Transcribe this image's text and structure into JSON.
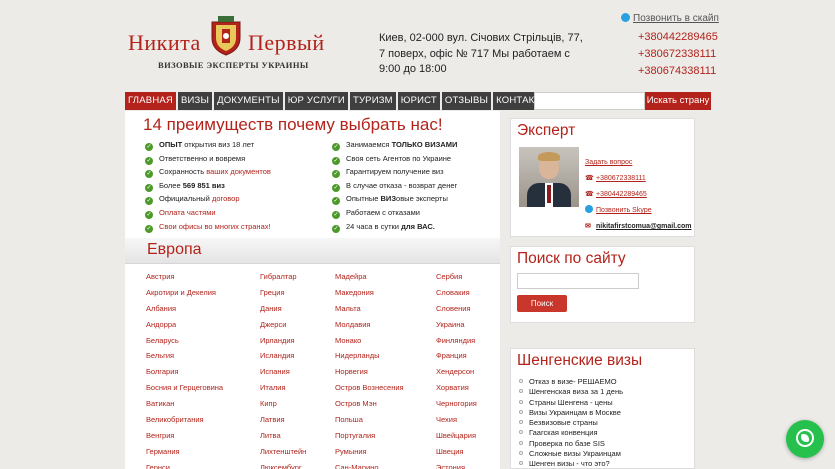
{
  "header": {
    "logo_word1": "Никита",
    "logo_word2": "Первый",
    "logo_sub": "ВИЗОВЫЕ ЭКСПЕРТЫ УКРАИНЫ",
    "address": "Киев, 02-000 вул. Січових Стрільців, 77, 7 поверх, офіс № 717  Мы работаем с 9:00 до 18:00",
    "call_skype": "Позвонить в скайп",
    "phones": [
      "+380442289465",
      "+380672338111",
      "+380674338111"
    ]
  },
  "nav": {
    "items": [
      "ГЛАВНАЯ",
      "ВИЗЫ",
      "ДОКУМЕНТЫ",
      "ЮР УСЛУГИ",
      "ТУРИЗМ",
      "ЮРИСТ",
      "ОТЗЫВЫ",
      "КОНТАКТЫ"
    ],
    "active_index": 0,
    "search_placeholder": "",
    "search_button": "Искать страну"
  },
  "advantages": {
    "title": "14 преимуществ почему выбрать нас!",
    "left": [
      {
        "pre": "",
        "bold": "ОПЫТ",
        "post": " открытия виз 18 лет",
        "red": false
      },
      {
        "pre": "Ответственно и вовремя",
        "bold": "",
        "post": "",
        "red": false
      },
      {
        "pre": "Сохранность ",
        "bold": "",
        "post": "",
        "red_tail": "ваших документов",
        "red": false
      },
      {
        "pre": "Более ",
        "bold": "569 851 виз",
        "post": "",
        "red": false
      },
      {
        "pre": "Официальный ",
        "bold": "",
        "post": "",
        "red_tail": "договор",
        "red": false
      },
      {
        "pre": "Оплата частями",
        "bold": "",
        "post": "",
        "red": true
      },
      {
        "pre": "Свои офисы во многих странах!",
        "bold": "",
        "post": "",
        "red": true
      }
    ],
    "right": [
      {
        "pre": "Занимаемся ",
        "bold": "ТОЛЬКО ВИЗАМИ",
        "post": ""
      },
      {
        "pre": "Своя сеть Агентов по Украине",
        "bold": "",
        "post": ""
      },
      {
        "pre": "Гарантируем получение виз",
        "bold": "",
        "post": ""
      },
      {
        "pre": "В случае отказа - возврат денег",
        "bold": "",
        "post": ""
      },
      {
        "pre": "Опытные ",
        "bold": "ВИЗ",
        "post": "овые эксперты"
      },
      {
        "pre": "Работаем с отказами",
        "bold": "",
        "post": ""
      },
      {
        "pre": "24 часа в сутки ",
        "bold": "для ВАС.",
        "post": ""
      }
    ]
  },
  "europe": {
    "title": "Европа",
    "columns": [
      [
        "Австрия",
        "Акротири и Декелия",
        "Албания",
        "Андорра",
        "Беларусь",
        "Бельгия",
        "Болгария",
        "Босния и Герцеговина",
        "Ватикан",
        "Великобритания",
        "Венгрия",
        "Германия",
        "Гернси"
      ],
      [
        "Гибралтар",
        "Греция",
        "Дания",
        "Джерси",
        "Ирландия",
        "Исландия",
        "Испания",
        "Италия",
        "Кипр",
        "Латвия",
        "Литва",
        "Лихтенштейн",
        "Люксембург"
      ],
      [
        "Мадейра",
        "Македония",
        "Мальта",
        "Молдавия",
        "Монако",
        "Нидерланды",
        "Норвегия",
        "Остров Вознесения",
        "Остров Мэн",
        "Польша",
        "Португалия",
        "Румыния",
        "Сан-Марино"
      ],
      [
        "Сербия",
        "Словакия",
        "Словения",
        "Украина",
        "Финляндия",
        "Франция",
        "Хендерсон",
        "Хорватия",
        "Черногория",
        "Чехия",
        "Швейцария",
        "Швеция",
        "Эстония"
      ]
    ]
  },
  "expert": {
    "title": "Эксперт",
    "ask": "Задать вопрос",
    "phone1": "+380672338111",
    "phone2": "+380442289465",
    "skype": "Позвонить Skype",
    "email": "nikitafirstcomua@gmail.com"
  },
  "site_search": {
    "title": "Поиск по сайту",
    "value": "",
    "button": "Поиск"
  },
  "schengen": {
    "title": "Шенгенские визы",
    "items": [
      "Отказ в визе- РЕШАЕМО",
      "Шенгенская виза за 1 день",
      "Страны Шенгена - цены",
      "Визы Украинцам в Москве",
      "Безвизовые страны",
      "Гаагская конвенция",
      "Проверка по базе SIS",
      "Сложные визы Украинцам",
      "Шенген визы - что это?"
    ]
  }
}
